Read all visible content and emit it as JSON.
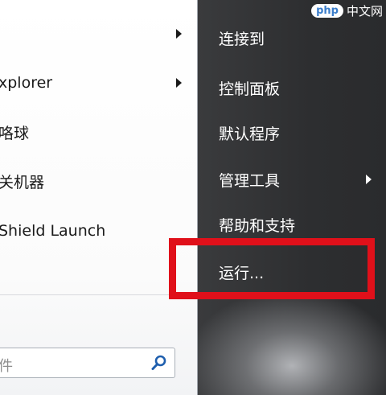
{
  "left_menu": {
    "items": [
      {
        "label": "",
        "has_arrow": true
      },
      {
        "label": "xplorer",
        "has_arrow": true
      },
      {
        "label": "咯球",
        "has_arrow": false
      },
      {
        "label": "关机器",
        "has_arrow": false
      },
      {
        "label": "Shield Launch",
        "has_arrow": false
      }
    ]
  },
  "search": {
    "text": "件",
    "icon": "search-icon"
  },
  "right_menu": {
    "items": [
      {
        "label": "连接到",
        "has_arrow": true
      },
      {
        "label": "控制面板",
        "has_arrow": false
      },
      {
        "label": "默认程序",
        "has_arrow": false
      },
      {
        "label": "管理工具",
        "has_arrow": true
      },
      {
        "label": "帮助和支持",
        "has_arrow": false
      },
      {
        "label": "运行...",
        "has_arrow": false
      }
    ]
  },
  "highlight": {
    "target": "运行...",
    "color": "#e0101a"
  },
  "watermark": {
    "badge": "php",
    "text": "中文网"
  }
}
